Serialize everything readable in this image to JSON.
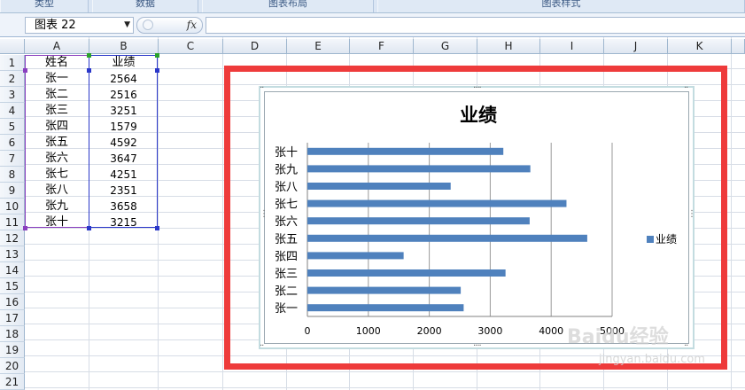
{
  "ribbon": {
    "groups": [
      "类型",
      "数据",
      "图表布局",
      "图表样式"
    ]
  },
  "formula_bar": {
    "name_box": "图表 22",
    "fx_label": "fx",
    "formula": ""
  },
  "columns": [
    "A",
    "B",
    "C",
    "D",
    "E",
    "F",
    "G",
    "H",
    "I",
    "J",
    "K"
  ],
  "rows": [
    "1",
    "2",
    "3",
    "4",
    "5",
    "6",
    "7",
    "8",
    "9",
    "10",
    "11",
    "12",
    "13",
    "14",
    "15",
    "16",
    "17",
    "18",
    "19",
    "20",
    "21"
  ],
  "sheet": {
    "header": {
      "name": "姓名",
      "score": "业绩"
    },
    "records": [
      {
        "name": "张一",
        "score": "2564"
      },
      {
        "name": "张二",
        "score": "2516"
      },
      {
        "name": "张三",
        "score": "3251"
      },
      {
        "name": "张四",
        "score": "1579"
      },
      {
        "name": "张五",
        "score": "4592"
      },
      {
        "name": "张六",
        "score": "3647"
      },
      {
        "name": "张七",
        "score": "4251"
      },
      {
        "name": "张八",
        "score": "2351"
      },
      {
        "name": "张九",
        "score": "3658"
      },
      {
        "name": "张十",
        "score": "3215"
      }
    ]
  },
  "colors": {
    "bar": "#4f81bd",
    "highlight": "#ee3b3b",
    "selection": "#2b38c9"
  },
  "chart_data": {
    "type": "bar",
    "orientation": "horizontal",
    "title": "业绩",
    "categories": [
      "张一",
      "张二",
      "张三",
      "张四",
      "张五",
      "张六",
      "张七",
      "张八",
      "张九",
      "张十"
    ],
    "series": [
      {
        "name": "业绩",
        "values": [
          2564,
          2516,
          3251,
          1579,
          4592,
          3647,
          4251,
          2351,
          3658,
          3215
        ]
      }
    ],
    "x_ticks": [
      "0",
      "1000",
      "2000",
      "3000",
      "4000",
      "5000"
    ],
    "xlim": [
      0,
      5000
    ],
    "grid": "vertical",
    "legend": "right"
  },
  "watermark": {
    "text": "Baidu经验",
    "url": "jingyan.baidu.com"
  }
}
